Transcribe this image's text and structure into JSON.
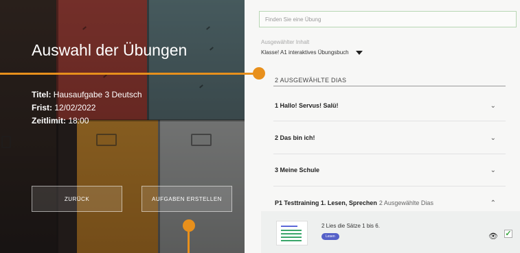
{
  "left": {
    "title": "Auswahl der Übungen",
    "meta": {
      "title_label": "Titel:",
      "title_value": " Hausaufgabe 3 Deutsch",
      "deadline_label": "Frist:",
      "deadline_value": " 12/02/2022",
      "time_label": "Zeitlimit:",
      "time_value": " 18:00"
    },
    "buttons": {
      "back": "ZURÜCK",
      "create": "AUFGABEN ERSTELLEN"
    }
  },
  "right": {
    "search_placeholder": "Finden Sie eine Übung",
    "selected_content_label": "Ausgewählter Inhalt",
    "selected_content_value": "Klasse! A1 interaktives Übungsbuch",
    "selected_count": "2 AUSGEWÄHLTE DIAS",
    "sections": [
      {
        "title": "1 Hallo! Servus! Salü!",
        "subtitle": "",
        "chevron": "⌄"
      },
      {
        "title": "2 Das bin ich!",
        "subtitle": "",
        "chevron": "⌄"
      },
      {
        "title": "3 Meine Schule",
        "subtitle": "",
        "chevron": "⌄"
      },
      {
        "title": "P1 Testtraining 1. Lesen, Sprechen",
        "subtitle": "2 Ausgewählte Dias",
        "chevron": "⌃"
      }
    ],
    "sub_item": {
      "title": "2 Lies die Sätze 1 bis 6.",
      "badge": "Lesen",
      "icons": [
        "eye-icon",
        "checkbox-checked-icon"
      ]
    }
  },
  "colors": {
    "accent_orange": "#e8901c",
    "badge_blue": "#5560c8",
    "check_green": "#3aa640"
  }
}
